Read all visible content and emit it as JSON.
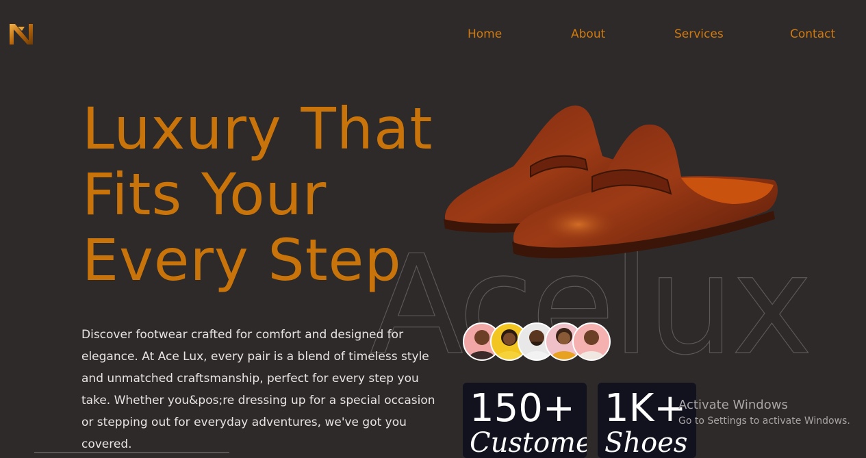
{
  "nav": {
    "items": [
      {
        "label": "Home"
      },
      {
        "label": "About"
      },
      {
        "label": "Services"
      },
      {
        "label": "Contact"
      }
    ]
  },
  "hero": {
    "title_lines": [
      "Luxury That",
      "Fits Your",
      "Every Step"
    ],
    "description": "Discover footwear crafted for comfort and designed for elegance. At Ace Lux, every pair is a blend of timeless style and unmatched craftsmanship, perfect for every step you take. Whether you&pos;re dressing up for a special occasion or stepping out for everyday adventures, we've got you covered.",
    "background_word": "Acelux"
  },
  "stats": [
    {
      "number": "150+",
      "label": "Customers"
    },
    {
      "number": "1K+",
      "label": "Shoes"
    }
  ],
  "os_watermark": {
    "title": "Activate Windows",
    "subtitle": "Go to Settings to activate Windows."
  },
  "colors": {
    "background": "#2e2a2a",
    "accent": "#c8740b",
    "nav": "#d07a10",
    "card": "#12121f"
  }
}
